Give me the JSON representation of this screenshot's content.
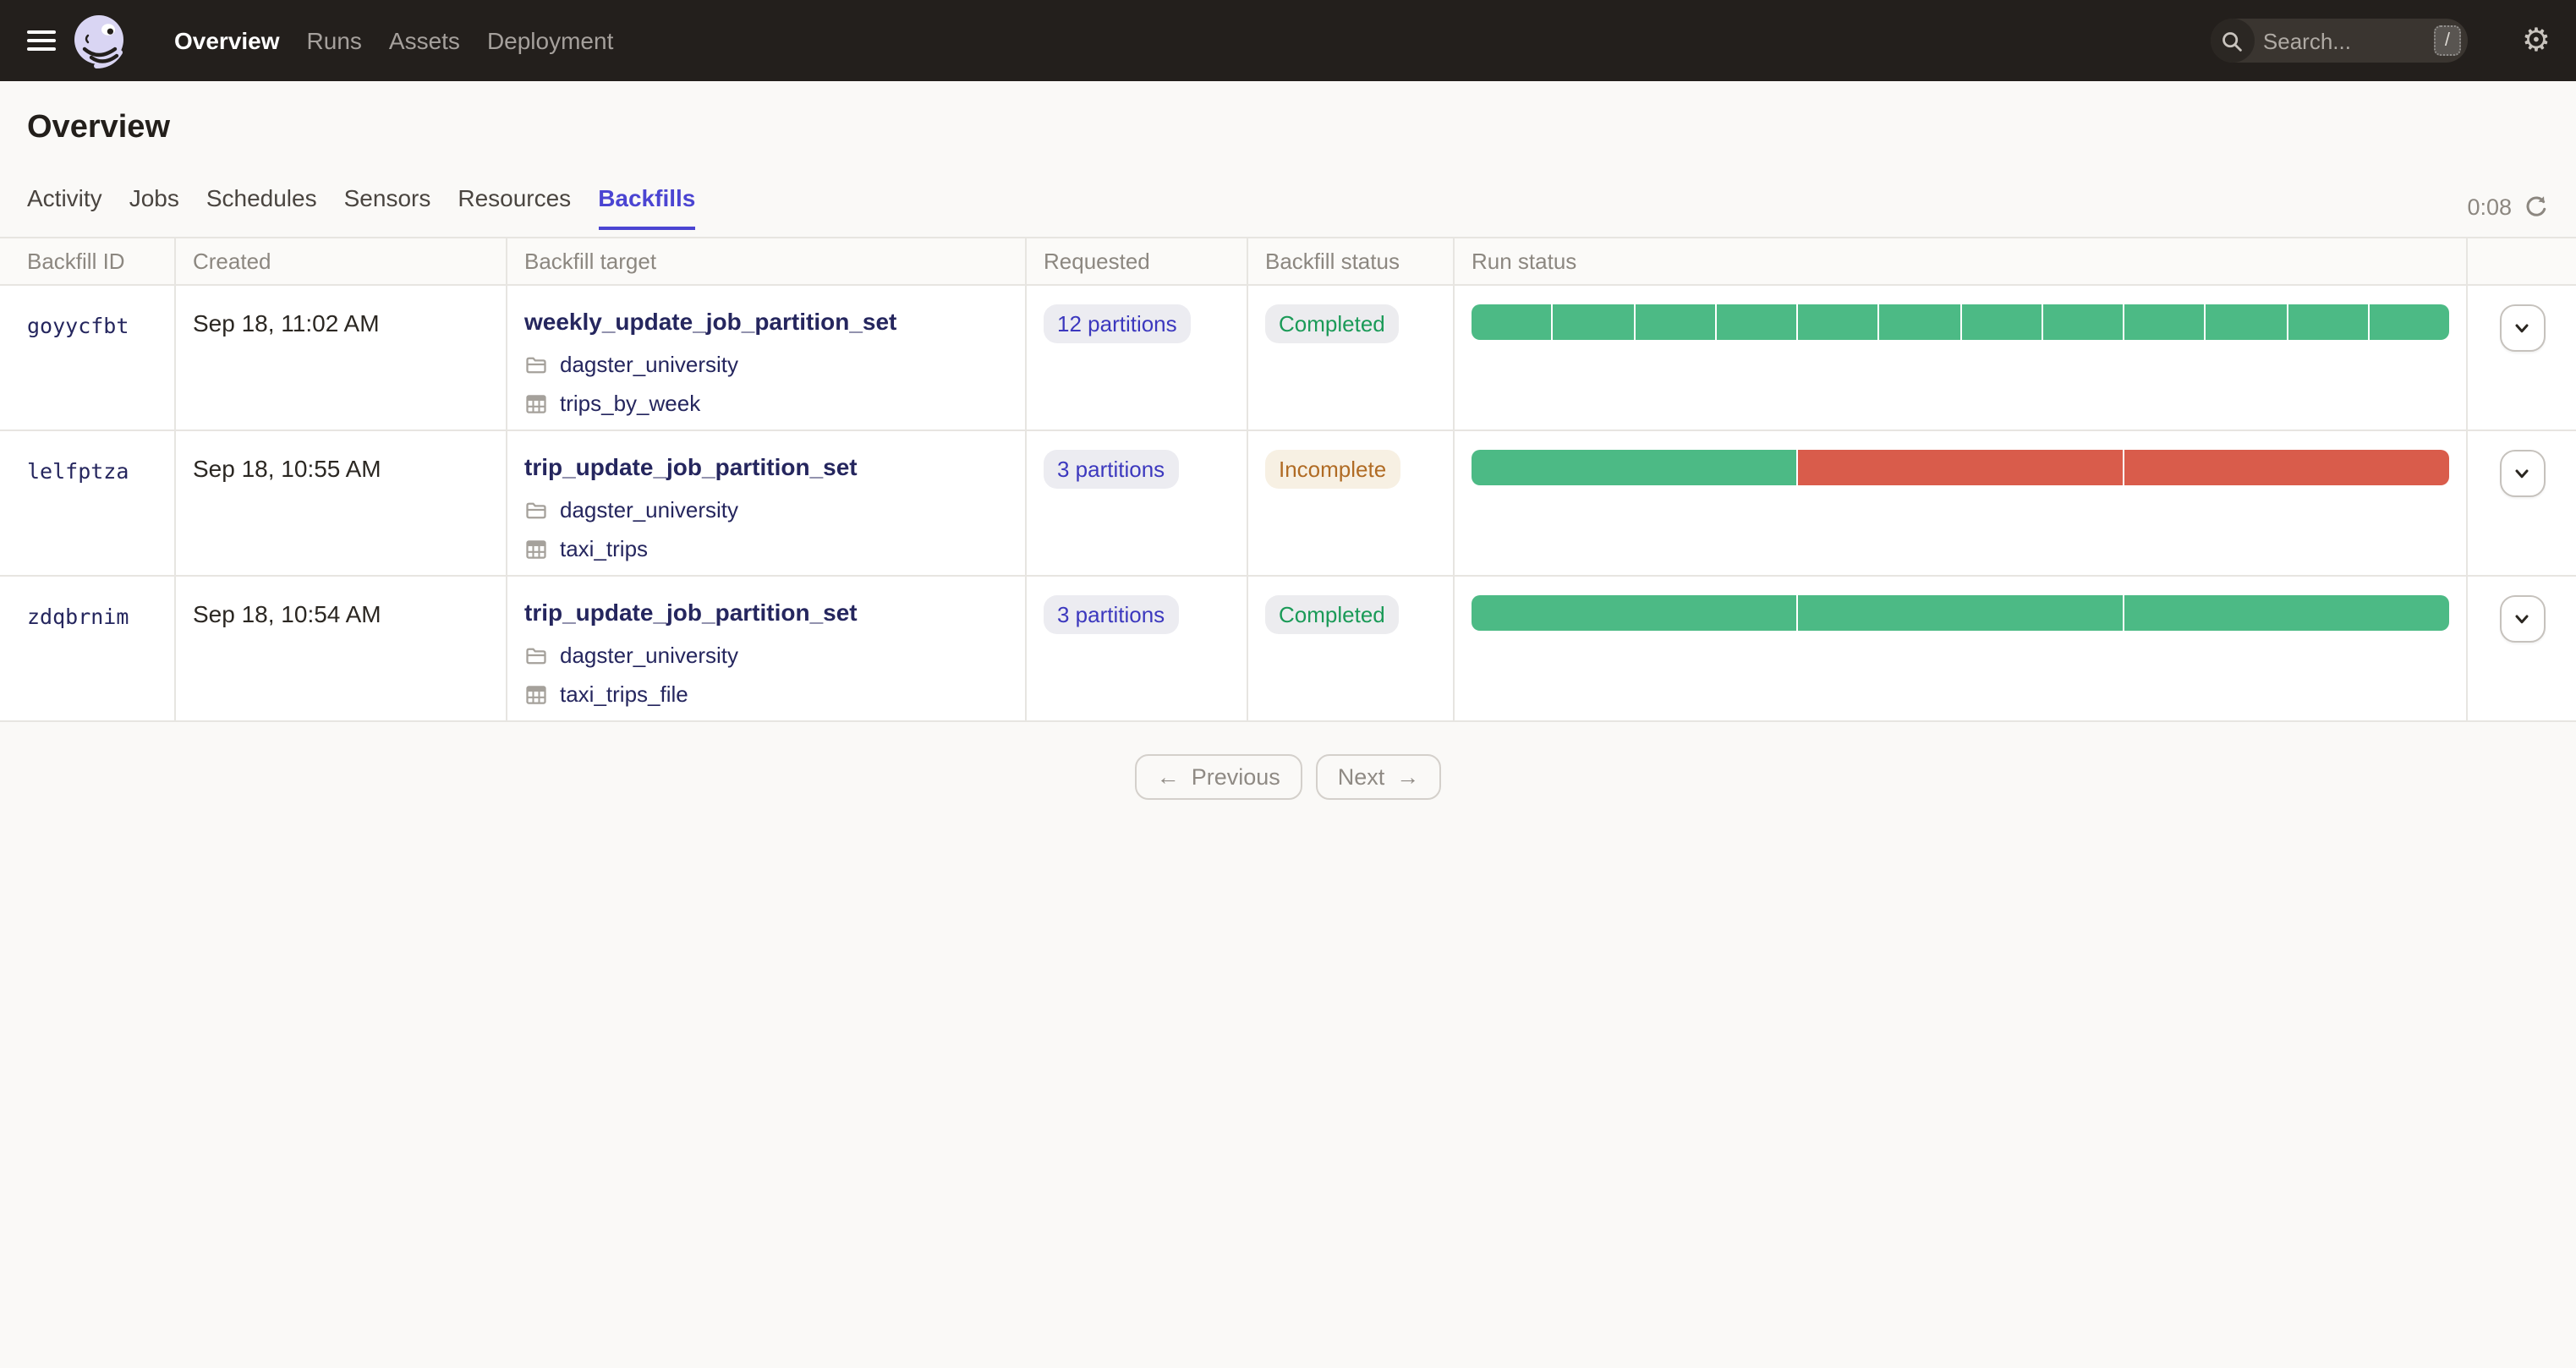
{
  "nav": {
    "items": [
      {
        "label": "Overview",
        "active": true
      },
      {
        "label": "Runs",
        "active": false
      },
      {
        "label": "Assets",
        "active": false
      },
      {
        "label": "Deployment",
        "active": false
      }
    ],
    "search": {
      "placeholder": "Search...",
      "shortcut": "/"
    }
  },
  "page": {
    "title": "Overview"
  },
  "tabs": [
    {
      "label": "Activity",
      "active": false
    },
    {
      "label": "Jobs",
      "active": false
    },
    {
      "label": "Schedules",
      "active": false
    },
    {
      "label": "Sensors",
      "active": false
    },
    {
      "label": "Resources",
      "active": false
    },
    {
      "label": "Backfills",
      "active": true
    }
  ],
  "refresh": {
    "countdown": "0:08"
  },
  "table": {
    "columns": [
      "Backfill ID",
      "Created",
      "Backfill target",
      "Requested",
      "Backfill status",
      "Run status"
    ],
    "rows": [
      {
        "id": "goyycfbt",
        "created": "Sep 18, 11:02 AM",
        "target": "weekly_update_job_partition_set",
        "code_location": "dagster_university",
        "partition_set": "trips_by_week",
        "requested": "12 partitions",
        "status": "Completed",
        "status_kind": "success",
        "run_segments": [
          "success",
          "success",
          "success",
          "success",
          "success",
          "success",
          "success",
          "success",
          "success",
          "success",
          "success",
          "success"
        ]
      },
      {
        "id": "lelfptza",
        "created": "Sep 18, 10:55 AM",
        "target": "trip_update_job_partition_set",
        "code_location": "dagster_university",
        "partition_set": "taxi_trips",
        "requested": "3 partitions",
        "status": "Incomplete",
        "status_kind": "warning",
        "run_segments": [
          "success",
          "failure",
          "failure"
        ]
      },
      {
        "id": "zdqbrnim",
        "created": "Sep 18, 10:54 AM",
        "target": "trip_update_job_partition_set",
        "code_location": "dagster_university",
        "partition_set": "taxi_trips_file",
        "requested": "3 partitions",
        "status": "Completed",
        "status_kind": "success",
        "run_segments": [
          "success",
          "success",
          "success"
        ]
      }
    ]
  },
  "pagination": {
    "previous": "Previous",
    "next": "Next",
    "prev_arrow": "←",
    "next_arrow": "→"
  },
  "colors": {
    "nav_background": "#231F1C",
    "page_background": "#FAF9F7",
    "accent_blue": "#4B45D2",
    "link_navy": "#25265E",
    "success_green": "#4CBA85",
    "failure_red": "#D95C4B",
    "success_text": "#1A9A57",
    "warning_text": "#B06B24"
  }
}
